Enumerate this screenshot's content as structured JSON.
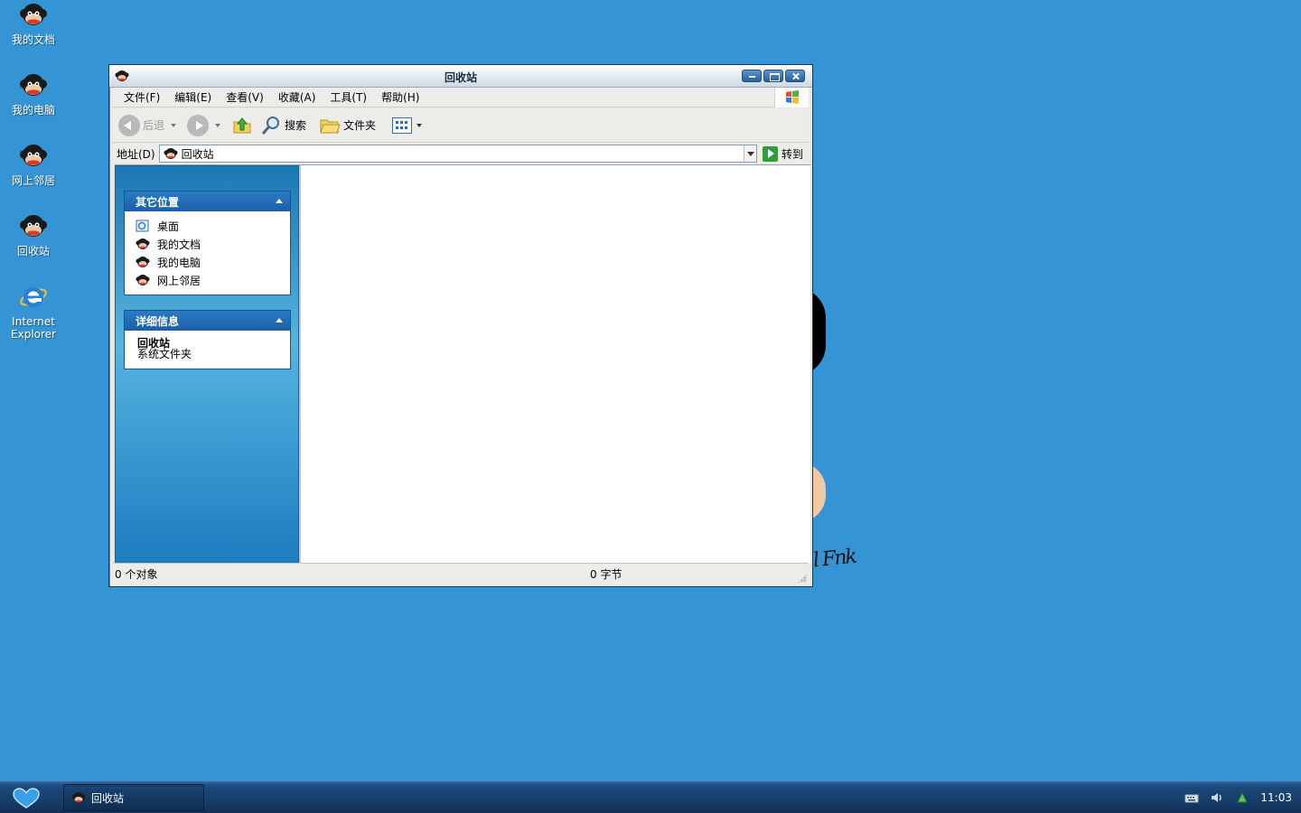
{
  "desktop": {
    "icons": [
      {
        "label": "我的文档"
      },
      {
        "label": "我的电脑"
      },
      {
        "label": "网上邻居"
      },
      {
        "label": "回收站"
      },
      {
        "label_line1": "Internet",
        "label_line2": "Explorer"
      }
    ]
  },
  "window": {
    "title": "回收站",
    "menu": [
      "文件(F)",
      "编辑(E)",
      "查看(V)",
      "收藏(A)",
      "工具(T)",
      "帮助(H)"
    ],
    "toolbar": {
      "back_label": "后退",
      "search_label": "搜索",
      "folders_label": "文件夹"
    },
    "address": {
      "label": "地址(D)",
      "value": "回收站",
      "go_label": "转到"
    },
    "taskpane": {
      "other_places": {
        "title": "其它位置",
        "items": [
          "桌面",
          "我的文档",
          "我的电脑",
          "网上邻居"
        ]
      },
      "details": {
        "title": "详细信息",
        "name": "回收站",
        "type": "系统文件夹"
      }
    },
    "status": {
      "objects": "0 个对象",
      "size": "0 字节"
    }
  },
  "taskbar": {
    "task_label": "回收站",
    "clock": "11:03"
  },
  "colors": {
    "desktop_bg": "#3594d3",
    "taskbar": "#163e6a",
    "taskpane": "#3ba0d8"
  }
}
